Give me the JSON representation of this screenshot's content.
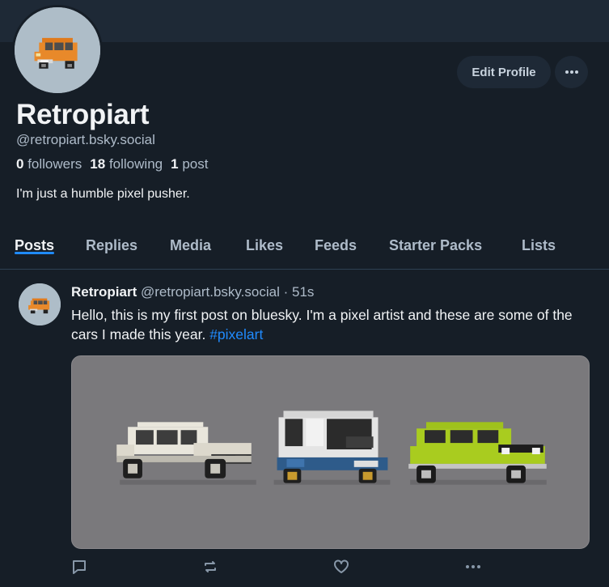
{
  "profile": {
    "display_name": "Retropiart",
    "handle": "@retropiart.bsky.social",
    "followers_count": "0",
    "followers_label": "followers",
    "following_count": "18",
    "following_label": "following",
    "posts_count": "1",
    "posts_label": "post",
    "bio": "I'm just a humble pixel pusher.",
    "edit_label": "Edit Profile",
    "more_icon": "ellipsis-icon"
  },
  "tabs": [
    {
      "label": "Posts",
      "active": true
    },
    {
      "label": "Replies"
    },
    {
      "label": "Media"
    },
    {
      "label": "Likes"
    },
    {
      "label": "Feeds"
    },
    {
      "label": "Starter Packs"
    },
    {
      "label": "Lists"
    }
  ],
  "post": {
    "author": "Retropiart",
    "handle": "@retropiart.bsky.social",
    "separator": "·",
    "time": "51s",
    "text": "Hello, this is my first post on bluesky. I'm a pixel artist and these are some of the cars I made this year.",
    "hashtag": "#pixelart",
    "media_alt_icons": [
      "white-hatchback-car",
      "boxy-van-car",
      "green-mini-car"
    ],
    "actions": [
      "reply-icon",
      "repost-icon",
      "like-icon",
      "more-icon"
    ]
  },
  "colors": {
    "background": "#161e27",
    "banner": "#1e2936",
    "accent": "#208bfe",
    "muted_text": "#aebbc9"
  }
}
